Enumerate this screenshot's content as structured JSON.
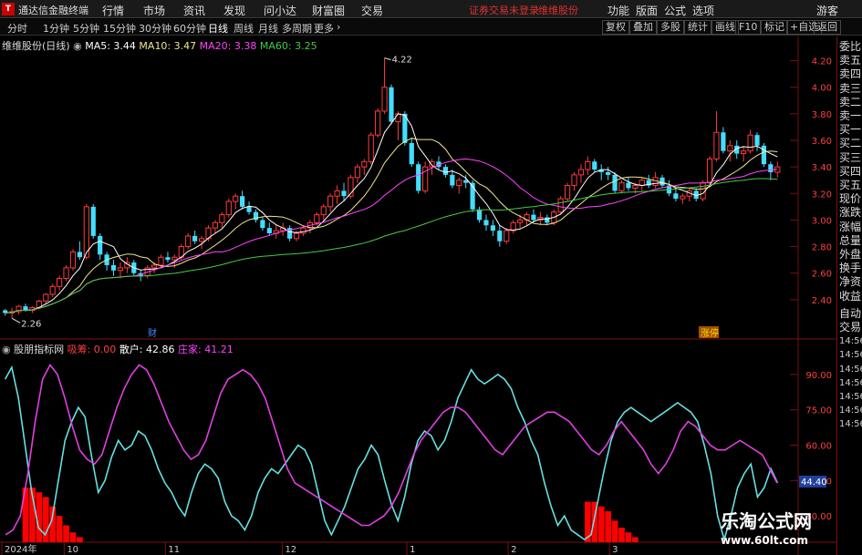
{
  "menubar": {
    "app_title": "通达信金融终端",
    "menus": [
      "行情",
      "市场",
      "资讯",
      "发现",
      "问小达",
      "财富圈",
      "交易"
    ],
    "status_warning": "证券交易未登录",
    "stock_link": "维维股份",
    "right_menus": [
      "功能",
      "版面",
      "公式",
      "选项"
    ],
    "guest": "游客"
  },
  "periodbar": {
    "periods": [
      "分时",
      "1分钟",
      "5分钟",
      "15分钟",
      "30分钟",
      "60分钟",
      "日线",
      "周线",
      "月线",
      "多周期",
      "更多"
    ],
    "active": "日线",
    "right_buttons": [
      "复权",
      "叠加",
      "多股",
      "统计",
      "画线",
      "F10",
      "标记",
      "+自选",
      "返回"
    ]
  },
  "price_panel": {
    "title": "维维股份(日线)",
    "ma": [
      {
        "label": "MA5: 3.44",
        "color": "#ffffff"
      },
      {
        "label": "MA10: 3.47",
        "color": "#f0e68c"
      },
      {
        "label": "MA20: 3.38",
        "color": "#ff44ff"
      },
      {
        "label": "MA60: 3.25",
        "color": "#44cc44"
      }
    ],
    "y_ticks": [
      "4.20",
      "4.00",
      "3.80",
      "3.60",
      "3.40",
      "3.20",
      "3.00",
      "2.80",
      "2.60",
      "2.40"
    ],
    "high_label": "4.22",
    "low_label": "2.26",
    "event_cai": "财",
    "event_zhangting": "涨停"
  },
  "indicator_panel": {
    "title": "股朋指标网",
    "items": [
      {
        "label": "吸筹: 0.00",
        "color": "#ff4040"
      },
      {
        "label": "散户: 42.86",
        "color": "#ffffff"
      },
      {
        "label": "庄家: 41.21",
        "color": "#ff44ff"
      }
    ],
    "y_ticks": [
      "90.00",
      "75.00",
      "60.00",
      "45.00",
      "30.00"
    ],
    "current_value": "44.40"
  },
  "x_axis": [
    "2024年",
    "10",
    "11",
    "12",
    "1",
    "2",
    "3"
  ],
  "right_column": {
    "items": [
      "委比",
      "卖五",
      "卖四",
      "卖三",
      "卖二",
      "卖一",
      "买一",
      "买二",
      "买三",
      "买四",
      "买五",
      "现价",
      "涨跌",
      "涨幅",
      "总量",
      "外盘",
      "换手",
      "净资",
      "收益",
      "自动",
      "交易",
      "14:56",
      "14:56",
      "14:56",
      "14:56",
      "14:56",
      "14:56",
      "14:56"
    ]
  },
  "watermark": {
    "title": "乐淘公式网",
    "url": "www.60lt.com"
  },
  "colors": {
    "up": "#ff3b3b",
    "down": "#44ddff",
    "border": "#7a1010",
    "ma5": "#ffffff",
    "ma10": "#f0e68c",
    "ma20": "#ff44ff",
    "ma60": "#44cc44",
    "sanhu": "#66e0e0",
    "zhuangjia": "#e040e0",
    "xichou": "#ff0000"
  },
  "chart_data": {
    "type": "candlestick",
    "price_ylim": [
      2.2,
      4.3
    ],
    "indicator_ylim": [
      20,
      100
    ],
    "candles": [
      [
        2.32,
        2.33,
        2.28,
        2.3
      ],
      [
        2.3,
        2.34,
        2.26,
        2.31
      ],
      [
        2.31,
        2.36,
        2.29,
        2.35
      ],
      [
        2.35,
        2.37,
        2.31,
        2.32
      ],
      [
        2.32,
        2.35,
        2.3,
        2.34
      ],
      [
        2.34,
        2.4,
        2.33,
        2.39
      ],
      [
        2.39,
        2.45,
        2.37,
        2.44
      ],
      [
        2.44,
        2.52,
        2.42,
        2.5
      ],
      [
        2.5,
        2.58,
        2.47,
        2.56
      ],
      [
        2.56,
        2.66,
        2.54,
        2.64
      ],
      [
        2.64,
        2.78,
        2.62,
        2.76
      ],
      [
        2.76,
        2.84,
        2.7,
        2.72
      ],
      [
        2.72,
        3.12,
        2.7,
        3.1
      ],
      [
        3.1,
        3.12,
        2.86,
        2.88
      ],
      [
        2.88,
        2.9,
        2.7,
        2.74
      ],
      [
        2.74,
        2.76,
        2.62,
        2.66
      ],
      [
        2.66,
        2.7,
        2.58,
        2.62
      ],
      [
        2.62,
        2.68,
        2.56,
        2.64
      ],
      [
        2.64,
        2.72,
        2.6,
        2.68
      ],
      [
        2.68,
        2.7,
        2.58,
        2.6
      ],
      [
        2.6,
        2.62,
        2.54,
        2.58
      ],
      [
        2.58,
        2.66,
        2.56,
        2.64
      ],
      [
        2.64,
        2.68,
        2.6,
        2.66
      ],
      [
        2.66,
        2.74,
        2.64,
        2.72
      ],
      [
        2.72,
        2.76,
        2.68,
        2.7
      ],
      [
        2.7,
        2.74,
        2.64,
        2.72
      ],
      [
        2.72,
        2.82,
        2.7,
        2.8
      ],
      [
        2.8,
        2.9,
        2.78,
        2.88
      ],
      [
        2.88,
        2.92,
        2.82,
        2.84
      ],
      [
        2.84,
        2.88,
        2.78,
        2.86
      ],
      [
        2.86,
        2.96,
        2.84,
        2.94
      ],
      [
        2.94,
        3.0,
        2.9,
        2.98
      ],
      [
        2.98,
        3.06,
        2.94,
        3.04
      ],
      [
        3.04,
        3.16,
        3.02,
        3.14
      ],
      [
        3.14,
        3.2,
        3.08,
        3.18
      ],
      [
        3.18,
        3.22,
        3.08,
        3.1
      ],
      [
        3.1,
        3.14,
        3.04,
        3.06
      ],
      [
        3.06,
        3.08,
        2.98,
        3.0
      ],
      [
        3.0,
        3.02,
        2.92,
        2.94
      ],
      [
        2.94,
        2.98,
        2.88,
        2.9
      ],
      [
        2.9,
        2.96,
        2.86,
        2.92
      ],
      [
        2.92,
        2.98,
        2.88,
        2.94
      ],
      [
        2.94,
        2.96,
        2.84,
        2.86
      ],
      [
        2.86,
        2.92,
        2.84,
        2.9
      ],
      [
        2.9,
        2.96,
        2.88,
        2.94
      ],
      [
        2.94,
        3.0,
        2.9,
        2.98
      ],
      [
        2.98,
        3.06,
        2.96,
        3.04
      ],
      [
        3.04,
        3.12,
        3.0,
        3.1
      ],
      [
        3.1,
        3.2,
        3.06,
        3.18
      ],
      [
        3.18,
        3.26,
        3.12,
        3.22
      ],
      [
        3.22,
        3.28,
        3.14,
        3.18
      ],
      [
        3.18,
        3.34,
        3.16,
        3.32
      ],
      [
        3.32,
        3.42,
        3.28,
        3.4
      ],
      [
        3.4,
        3.46,
        3.34,
        3.44
      ],
      [
        3.44,
        3.66,
        3.42,
        3.64
      ],
      [
        3.64,
        3.84,
        3.62,
        3.82
      ],
      [
        3.82,
        4.22,
        3.8,
        4.0
      ],
      [
        4.0,
        4.02,
        3.72,
        3.74
      ],
      [
        3.74,
        3.82,
        3.6,
        3.8
      ],
      [
        3.8,
        3.82,
        3.56,
        3.58
      ],
      [
        3.58,
        3.62,
        3.4,
        3.42
      ],
      [
        3.42,
        3.44,
        3.2,
        3.22
      ],
      [
        3.22,
        3.44,
        3.2,
        3.4
      ],
      [
        3.4,
        3.46,
        3.34,
        3.44
      ],
      [
        3.44,
        3.48,
        3.38,
        3.4
      ],
      [
        3.4,
        3.42,
        3.32,
        3.34
      ],
      [
        3.34,
        3.38,
        3.24,
        3.26
      ],
      [
        3.26,
        3.32,
        3.2,
        3.3
      ],
      [
        3.3,
        3.34,
        3.24,
        3.28
      ],
      [
        3.28,
        3.3,
        3.06,
        3.08
      ],
      [
        3.08,
        3.1,
        2.98,
        3.0
      ],
      [
        3.0,
        3.04,
        2.92,
        2.96
      ],
      [
        2.96,
        3.0,
        2.88,
        2.92
      ],
      [
        2.92,
        2.96,
        2.8,
        2.84
      ],
      [
        2.84,
        2.94,
        2.82,
        2.92
      ],
      [
        2.92,
        3.0,
        2.9,
        2.98
      ],
      [
        2.98,
        3.04,
        2.94,
        3.0
      ],
      [
        3.0,
        3.06,
        2.96,
        3.04
      ],
      [
        3.04,
        3.08,
        2.98,
        3.0
      ],
      [
        3.0,
        3.06,
        2.96,
        3.02
      ],
      [
        3.02,
        3.04,
        2.96,
        2.98
      ],
      [
        2.98,
        3.08,
        2.96,
        3.06
      ],
      [
        3.06,
        3.18,
        3.04,
        3.16
      ],
      [
        3.16,
        3.28,
        3.14,
        3.26
      ],
      [
        3.26,
        3.36,
        3.22,
        3.34
      ],
      [
        3.34,
        3.42,
        3.28,
        3.38
      ],
      [
        3.38,
        3.48,
        3.34,
        3.44
      ],
      [
        3.44,
        3.46,
        3.36,
        3.38
      ],
      [
        3.38,
        3.42,
        3.3,
        3.36
      ],
      [
        3.36,
        3.4,
        3.3,
        3.34
      ],
      [
        3.34,
        3.36,
        3.2,
        3.22
      ],
      [
        3.22,
        3.3,
        3.2,
        3.28
      ],
      [
        3.28,
        3.32,
        3.22,
        3.24
      ],
      [
        3.24,
        3.28,
        3.2,
        3.26
      ],
      [
        3.26,
        3.32,
        3.22,
        3.3
      ],
      [
        3.3,
        3.34,
        3.24,
        3.26
      ],
      [
        3.26,
        3.36,
        3.24,
        3.32
      ],
      [
        3.32,
        3.34,
        3.24,
        3.26
      ],
      [
        3.26,
        3.3,
        3.18,
        3.2
      ],
      [
        3.2,
        3.24,
        3.14,
        3.16
      ],
      [
        3.16,
        3.2,
        3.12,
        3.18
      ],
      [
        3.18,
        3.24,
        3.14,
        3.22
      ],
      [
        3.22,
        3.24,
        3.14,
        3.16
      ],
      [
        3.16,
        3.3,
        3.14,
        3.28
      ],
      [
        3.28,
        3.48,
        3.26,
        3.46
      ],
      [
        3.46,
        3.82,
        3.44,
        3.66
      ],
      [
        3.66,
        3.7,
        3.5,
        3.52
      ],
      [
        3.52,
        3.6,
        3.44,
        3.56
      ],
      [
        3.56,
        3.6,
        3.46,
        3.5
      ],
      [
        3.5,
        3.56,
        3.44,
        3.52
      ],
      [
        3.52,
        3.68,
        3.5,
        3.64
      ],
      [
        3.64,
        3.66,
        3.52,
        3.56
      ],
      [
        3.56,
        3.58,
        3.4,
        3.42
      ],
      [
        3.42,
        3.44,
        3.3,
        3.36
      ],
      [
        3.36,
        3.44,
        3.32,
        3.4
      ]
    ],
    "ma_periods": [
      5,
      10,
      20,
      60
    ],
    "sanhu": [
      88,
      93,
      80,
      60,
      40,
      25,
      22,
      28,
      45,
      62,
      70,
      76,
      72,
      55,
      40,
      45,
      55,
      62,
      58,
      60,
      66,
      64,
      58,
      50,
      44,
      40,
      34,
      30,
      40,
      48,
      52,
      50,
      46,
      36,
      30,
      28,
      24,
      30,
      40,
      46,
      50,
      48,
      52,
      56,
      60,
      58,
      52,
      40,
      28,
      22,
      28,
      34,
      42,
      50,
      54,
      60,
      56,
      45,
      35,
      28,
      38,
      52,
      62,
      66,
      64,
      58,
      62,
      70,
      80,
      86,
      92,
      88,
      86,
      88,
      90,
      88,
      84,
      76,
      70,
      62,
      56,
      44,
      34,
      26,
      30,
      24,
      22,
      20,
      22,
      36,
      50,
      62,
      70,
      74,
      76,
      74,
      72,
      70,
      72,
      74,
      76,
      78,
      76,
      74,
      70,
      60,
      48,
      30,
      20,
      30,
      42,
      48,
      52,
      38,
      42,
      50,
      44
    ],
    "zhuangjia": [
      22,
      24,
      30,
      48,
      70,
      88,
      94,
      90,
      80,
      68,
      58,
      54,
      52,
      56,
      66,
      76,
      84,
      90,
      94,
      92,
      86,
      78,
      70,
      64,
      58,
      54,
      56,
      62,
      72,
      82,
      88,
      90,
      92,
      90,
      86,
      80,
      70,
      60,
      50,
      44,
      42,
      40,
      38,
      36,
      34,
      32,
      30,
      28,
      26,
      26,
      28,
      30,
      34,
      40,
      48,
      56,
      62,
      66,
      70,
      74,
      76,
      76,
      74,
      70,
      66,
      62,
      58,
      56,
      60,
      64,
      68,
      70,
      72,
      74,
      74,
      72,
      70,
      66,
      62,
      58,
      56,
      60,
      66,
      70,
      66,
      62,
      58,
      52,
      48,
      52,
      58,
      66,
      70,
      68,
      64,
      60,
      58,
      58,
      60,
      62,
      60,
      58,
      56,
      50,
      44
    ],
    "xichou": [
      0,
      0,
      0,
      22,
      22,
      20,
      18,
      14,
      10,
      6,
      3,
      1,
      0,
      0,
      0,
      0,
      0,
      0,
      0,
      0,
      0,
      0,
      0,
      0,
      0,
      0,
      0,
      0,
      0,
      0,
      0,
      0,
      0,
      0,
      0,
      0,
      0,
      0,
      0,
      0,
      0,
      0,
      0,
      0,
      0,
      0,
      0,
      0,
      0,
      0,
      0,
      0,
      0,
      0,
      0,
      0,
      0,
      0,
      0,
      0,
      0,
      0,
      0,
      0,
      0,
      0,
      0,
      0,
      0,
      0,
      0,
      0,
      0,
      0,
      0,
      0,
      0,
      0,
      0,
      0,
      0,
      0,
      0,
      0,
      0,
      0,
      16,
      16,
      14,
      12,
      8,
      5,
      3,
      1,
      0,
      0,
      0,
      0,
      0,
      0,
      0,
      0,
      0,
      0,
      0,
      0,
      0,
      0,
      0,
      0,
      0,
      0,
      0,
      0,
      0,
      0,
      0,
      0
    ]
  }
}
